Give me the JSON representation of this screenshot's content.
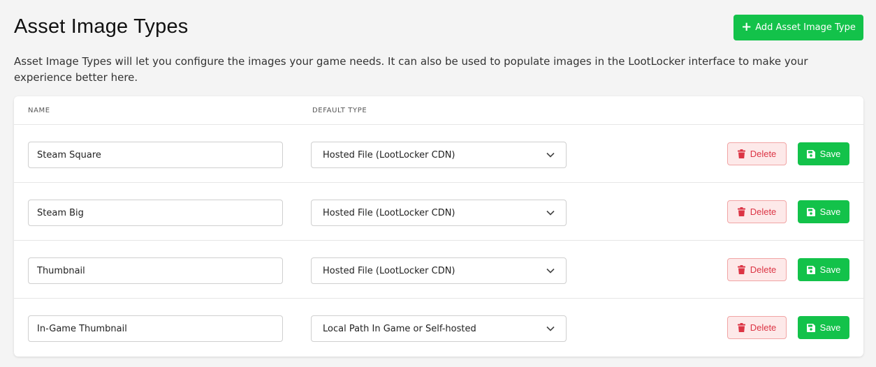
{
  "header": {
    "title": "Asset Image Types",
    "add_button_label": "Add Asset Image Type",
    "description": "Asset Image Types will let you configure the images your game needs. It can also be used to populate images in the LootLocker interface to make your experience better here."
  },
  "table": {
    "columns": [
      "NAME",
      "DEFAULT TYPE"
    ],
    "rows": [
      {
        "name": "Steam Square",
        "default_type": "Hosted File (LootLocker CDN)",
        "delete_label": "Delete",
        "save_label": "Save"
      },
      {
        "name": "Steam Big",
        "default_type": "Hosted File (LootLocker CDN)",
        "delete_label": "Delete",
        "save_label": "Save"
      },
      {
        "name": "Thumbnail",
        "default_type": "Hosted File (LootLocker CDN)",
        "delete_label": "Delete",
        "save_label": "Save"
      },
      {
        "name": "In-Game Thumbnail",
        "default_type": "Local Path In Game or Self-hosted",
        "delete_label": "Delete",
        "save_label": "Save"
      }
    ]
  },
  "icons": {
    "add": "plus-icon",
    "delete": "trash-icon",
    "save": "floppy-disk-icon",
    "select": "chevron-down-icon"
  },
  "colors": {
    "primary_green": "#13c24a",
    "danger_red": "#dc3545",
    "danger_bg": "#fde9e9",
    "page_bg": "#f4f4f4"
  }
}
